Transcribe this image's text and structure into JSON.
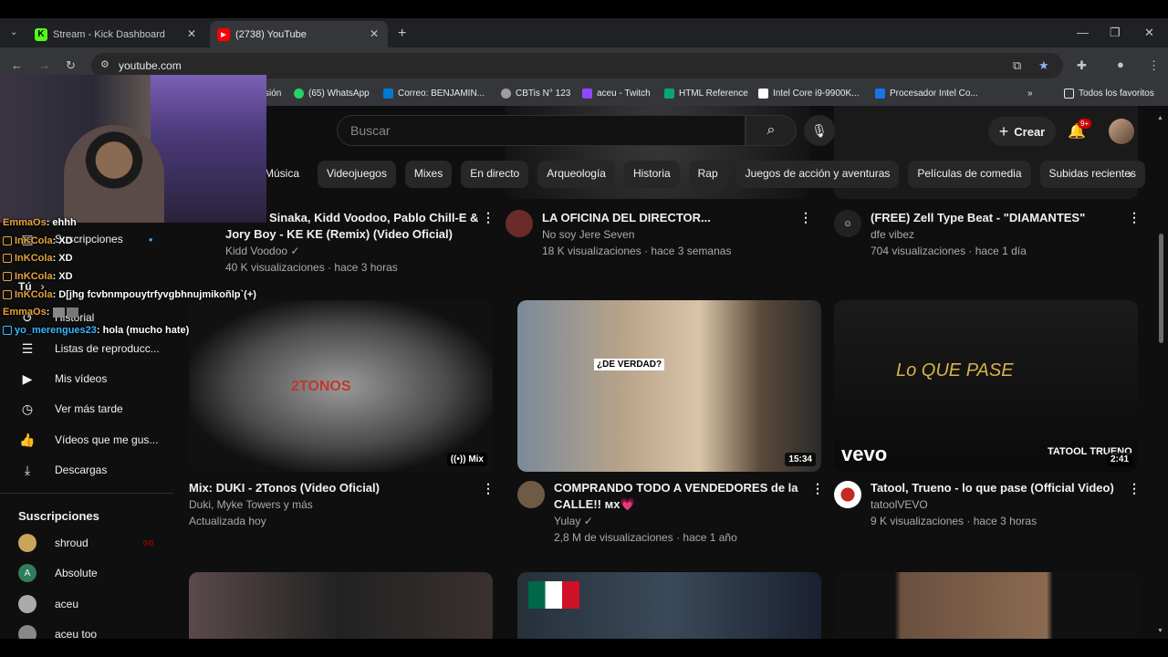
{
  "tabs": [
    {
      "label": "Stream - Kick Dashboard",
      "icon": "kick-icon",
      "color": "#53fc18"
    },
    {
      "label": "(2738) YouTube",
      "icon": "youtube-icon",
      "color": "#ff0000"
    }
  ],
  "address": {
    "url": "youtube.com"
  },
  "bookmarks": [
    {
      "label": "sión"
    },
    {
      "label": "(65) WhatsApp",
      "color": "#25d366"
    },
    {
      "label": "Correo: BENJAMIN...",
      "color": "#0078d4"
    },
    {
      "label": "CBTis N° 123",
      "color": "#9e9e9e"
    },
    {
      "label": "aceu - Twitch",
      "color": "#9146ff"
    },
    {
      "label": "HTML Reference",
      "color": "#04aa6d"
    },
    {
      "label": "Intel Core i9-9900K...",
      "color": "#ffffff"
    },
    {
      "label": "Procesador Intel Co...",
      "color": "#1a73e8"
    },
    {
      "label": "Todos los favoritos"
    }
  ],
  "header": {
    "search_placeholder": "Buscar",
    "create_label": "Crear",
    "notif_badge": "9+"
  },
  "chips": [
    "Música",
    "Videojuegos",
    "Mixes",
    "En directo",
    "Arqueología",
    "Historia",
    "Rap",
    "Juegos de acción y aventuras",
    "Películas de comedia",
    "Subidas recientes"
  ],
  "row1": [
    {
      "title_1": "Sinaka, Kidd Voodoo, Pablo Chill-E &",
      "title_2": "Jory Boy - KE KE (Remix) (Video Oficial)",
      "channel": "Kidd Voodoo",
      "meta": "40 K visualizaciones · hace 3 horas"
    },
    {
      "title_1": "LA OFICINA DEL DIRECTOR...",
      "channel": "No soy Jere Seven",
      "meta": "18 K visualizaciones · hace 3 semanas"
    },
    {
      "title_1": "(FREE) Zell Type Beat - \"DIAMANTES\"",
      "channel": "dfe vibez",
      "meta": "704 visualizaciones · hace 1 día"
    }
  ],
  "row2": [
    {
      "title_1": "Mix: DUKI - 2Tonos (Video Oficial)",
      "channel": "Duki, Myke Towers y más",
      "meta": "Actualizada hoy",
      "overlay": "Mix",
      "thumb_text": "2TONOS"
    },
    {
      "title_1": "COMPRANDO TODO A VENDEDORES de la",
      "title_2": "CALLE!! мх💗",
      "channel": "Yulay",
      "meta": "2,8 M de visualizaciones · hace 1 año",
      "duration": "15:34",
      "thumb_text": "¿DE VERDAD?"
    },
    {
      "title_1": "Tatool, Trueno - lo que pase (Official Video)",
      "channel": "tatoolVEVO",
      "meta": "9 K visualizaciones · hace 3 horas",
      "duration": "2:41",
      "thumb_text": "Lo QUE PASE",
      "vevo": "vevo",
      "thumb_label": "TATOOL TRUENO"
    }
  ],
  "sidebar": {
    "items": [
      "Suscripciones",
      "Tú",
      "Historial",
      "Listas de reproducc...",
      "Mis vídeos",
      "Ver más tarde",
      "Vídeos que me gus...",
      "Descargas"
    ],
    "subs_title": "Suscripciones",
    "subs": [
      {
        "name": "shroud",
        "live": "0/0"
      },
      {
        "name": "Absolute",
        "initial": "A"
      },
      {
        "name": "aceu"
      },
      {
        "name": "aceu too"
      }
    ]
  },
  "chat": [
    {
      "user": "EmmaOs",
      "msg": ": ehhh"
    },
    {
      "user": "InKCola",
      "msg": ": XD"
    },
    {
      "user": "InKCola",
      "msg": ": XD"
    },
    {
      "user": "InKCola",
      "msg": ": XD"
    },
    {
      "user": "InKCola",
      "msg": ": D[jhg fcvbnmpouytrfyvgbhnujmikoñlp`(+)"
    },
    {
      "user": "EmmaOs",
      "msg": ":"
    },
    {
      "user": "yo_merengues23",
      "msg": ": hola (mucho hate)"
    }
  ]
}
